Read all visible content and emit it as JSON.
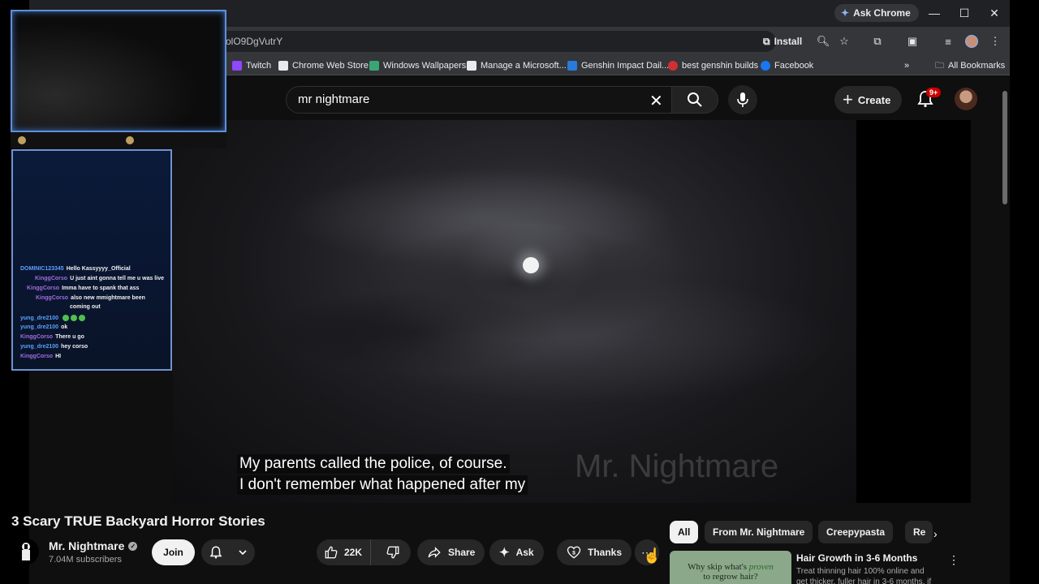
{
  "browser": {
    "ask_chrome": "Ask Chrome",
    "url_fragment": "olO9DgVutrY",
    "install_label": "Install",
    "bookmarks": [
      "Twitch",
      "Chrome Web Store",
      "Windows Wallpapers",
      "Manage a Microsoft...",
      "Genshin Impact Dail...",
      "best genshin builds",
      "Facebook"
    ],
    "all_bookmarks": "All Bookmarks",
    "more_bookmarks": "»"
  },
  "youtube": {
    "search_value": "mr nightmare",
    "create_label": "Create",
    "notification_badge": "9+"
  },
  "video": {
    "caption_line1": "My parents called the police, of course.",
    "caption_line2": "I don't remember what happened after my",
    "watermark": "Mr. Nightmare",
    "title": "3 Scary TRUE Backyard Horror Stories"
  },
  "channel": {
    "name": "Mr. Nightmare",
    "subscribers": "7.04M subscribers",
    "join_label": "Join"
  },
  "actions": {
    "likes": "22K",
    "share_label": "Share",
    "ask_label": "Ask",
    "thanks_label": "Thanks"
  },
  "chips": [
    "All",
    "From Mr. Nightmare",
    "Creepypasta",
    "Re"
  ],
  "ad": {
    "thumb_text_1": "Why skip what's",
    "thumb_text_em": "proven",
    "thumb_text_2": "to regrow hair?",
    "title": "Hair Growth in 3-6 Months",
    "text": "Treat thinning hair 100% online and get thicker, fuller hair in 3-6 months, if"
  },
  "chat": [
    {
      "user": "DOMINIC123345",
      "msg": "Hello Kassyyyy_Official",
      "color": "blue"
    },
    {
      "user": "KinggCorso",
      "msg": "U just aint gonna tell me u was live",
      "color": "purple"
    },
    {
      "user": "KinggCorso",
      "msg": "Imma have to spank that ass",
      "color": "purple"
    },
    {
      "user": "KinggCorso",
      "msg": "also new mmightmare been",
      "msg2": "coming out",
      "color": "purple"
    },
    {
      "user": "yung_dre2100",
      "msg": "",
      "color": "blue"
    },
    {
      "user": "yung_dre2100",
      "msg": "ok",
      "color": "blue"
    },
    {
      "user": "KinggCorso",
      "msg": "There u go",
      "color": "purple"
    },
    {
      "user": "yung_dre2100",
      "msg": "hey corso",
      "color": "blue"
    },
    {
      "user": "KinggCorso",
      "msg": "HI",
      "color": "purple"
    }
  ],
  "colors": {
    "accent_red": "#cc0000",
    "overlay_border": "#6f93d0",
    "chat_user_blue": "#5aa0ff",
    "chat_user_purple": "#a06be0"
  }
}
